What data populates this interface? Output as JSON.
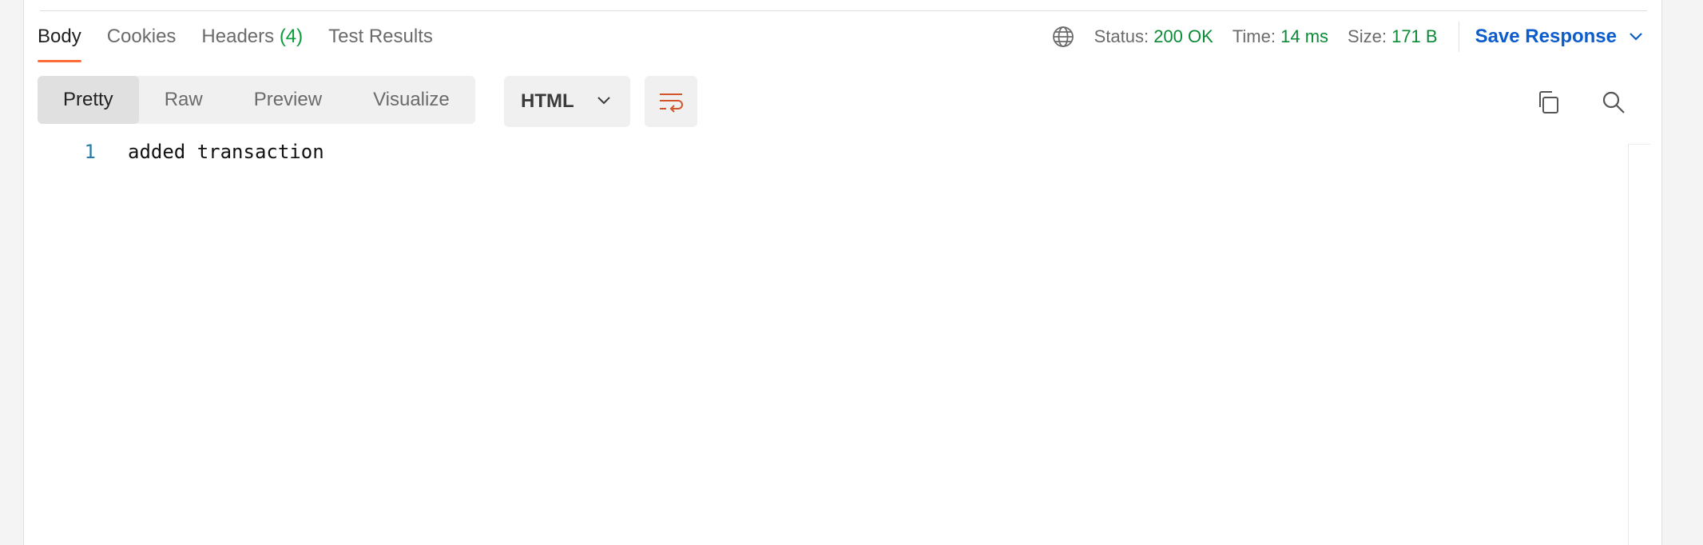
{
  "tabs": [
    {
      "label": "Body",
      "active": true
    },
    {
      "label": "Cookies"
    },
    {
      "label": "Headers",
      "count": "(4)"
    },
    {
      "label": "Test Results"
    }
  ],
  "meta": {
    "status_label": "Status:",
    "status_value": "200 OK",
    "time_label": "Time:",
    "time_value": "14 ms",
    "size_label": "Size:",
    "size_value": "171 B",
    "save_label": "Save Response"
  },
  "view_modes": [
    "Pretty",
    "Raw",
    "Preview",
    "Visualize"
  ],
  "format": {
    "selected": "HTML"
  },
  "editor": {
    "lines": [
      {
        "number": "1",
        "text": "added transaction"
      }
    ]
  },
  "colors": {
    "accent": "#ff6c37",
    "status_green": "#0b8a35",
    "link_blue": "#0d5ccc"
  },
  "icons": [
    "globe-icon",
    "chevron-down-icon",
    "wrap-lines-icon",
    "copy-icon",
    "search-icon"
  ]
}
